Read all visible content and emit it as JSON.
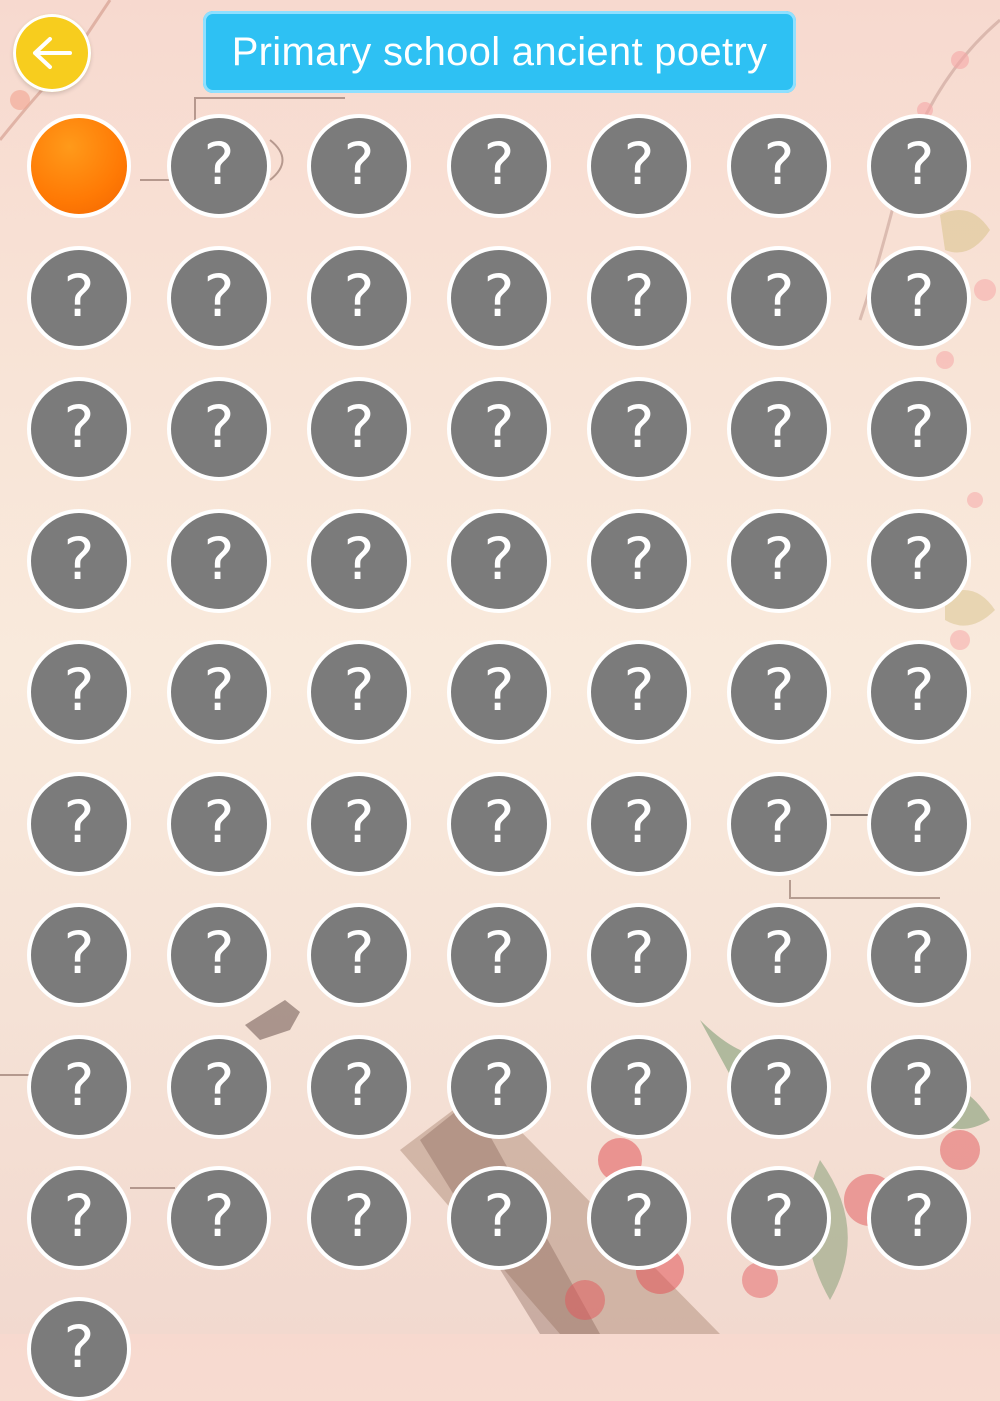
{
  "header": {
    "back_icon": "arrow-left-icon",
    "title": "Primary school ancient poetry"
  },
  "colors": {
    "back_button": "#f7cd1e",
    "title_bar": "#2ec1f3",
    "locked_level": "#7b7b7b",
    "current_level": "#ff7a05"
  },
  "levels": {
    "current_index": 0,
    "locked_icon": "question-mark-icon",
    "locked_label": "?"
  }
}
